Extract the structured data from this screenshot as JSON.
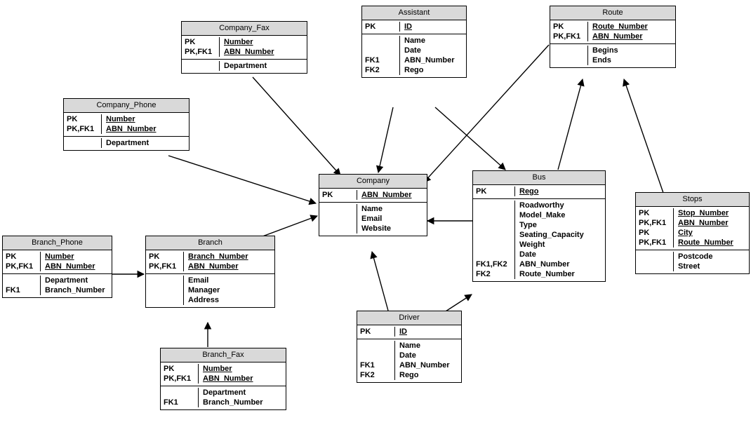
{
  "entities": {
    "company_fax": {
      "title": "Company_Fax",
      "sections": [
        {
          "keys": [
            "PK",
            "PK,FK1"
          ],
          "attrs": [
            "Number",
            "ABN_Number"
          ],
          "pk": [
            true,
            true
          ]
        },
        {
          "keys": [
            ""
          ],
          "attrs": [
            "Department"
          ],
          "pk": [
            false
          ]
        }
      ]
    },
    "company_phone": {
      "title": "Company_Phone",
      "sections": [
        {
          "keys": [
            "PK",
            "PK,FK1"
          ],
          "attrs": [
            "Number",
            "ABN_Number"
          ],
          "pk": [
            true,
            true
          ]
        },
        {
          "keys": [
            ""
          ],
          "attrs": [
            "Department"
          ],
          "pk": [
            false
          ]
        }
      ]
    },
    "branch_phone": {
      "title": "Branch_Phone",
      "sections": [
        {
          "keys": [
            "PK",
            "PK,FK1"
          ],
          "attrs": [
            "Number",
            "ABN_Number"
          ],
          "pk": [
            true,
            true
          ]
        },
        {
          "keys": [
            "",
            "FK1"
          ],
          "attrs": [
            "Department",
            "Branch_Number"
          ],
          "pk": [
            false,
            false
          ]
        }
      ]
    },
    "branch": {
      "title": "Branch",
      "sections": [
        {
          "keys": [
            "PK",
            "PK,FK1"
          ],
          "attrs": [
            "Branch_Number",
            "ABN_Number"
          ],
          "pk": [
            true,
            true
          ]
        },
        {
          "keys": [
            "",
            "",
            ""
          ],
          "attrs": [
            "Email",
            "Manager",
            "Address"
          ],
          "pk": [
            false,
            false,
            false
          ]
        }
      ]
    },
    "branch_fax": {
      "title": "Branch_Fax",
      "sections": [
        {
          "keys": [
            "PK",
            "PK,FK1"
          ],
          "attrs": [
            "Number",
            "ABN_Number"
          ],
          "pk": [
            true,
            true
          ]
        },
        {
          "keys": [
            "",
            "FK1"
          ],
          "attrs": [
            "Department",
            "Branch_Number"
          ],
          "pk": [
            false,
            false
          ]
        }
      ]
    },
    "assistant": {
      "title": "Assistant",
      "sections": [
        {
          "keys": [
            "PK"
          ],
          "attrs": [
            "ID"
          ],
          "pk": [
            true
          ]
        },
        {
          "keys": [
            "",
            "",
            "FK1",
            "FK2"
          ],
          "attrs": [
            "Name",
            "Date",
            "ABN_Number",
            "Rego"
          ],
          "pk": [
            false,
            false,
            false,
            false
          ]
        }
      ]
    },
    "company": {
      "title": "Company",
      "sections": [
        {
          "keys": [
            "PK"
          ],
          "attrs": [
            "ABN_Number"
          ],
          "pk": [
            true
          ]
        },
        {
          "keys": [
            "",
            "",
            ""
          ],
          "attrs": [
            "Name",
            "Email",
            "Website"
          ],
          "pk": [
            false,
            false,
            false
          ]
        }
      ]
    },
    "driver": {
      "title": "Driver",
      "sections": [
        {
          "keys": [
            "PK"
          ],
          "attrs": [
            "ID"
          ],
          "pk": [
            true
          ]
        },
        {
          "keys": [
            "",
            "",
            "FK1",
            "FK2"
          ],
          "attrs": [
            "Name",
            "Date",
            "ABN_Number",
            "Rego"
          ],
          "pk": [
            false,
            false,
            false,
            false
          ]
        }
      ]
    },
    "bus": {
      "title": "Bus",
      "sections": [
        {
          "keys": [
            "PK"
          ],
          "attrs": [
            "Rego"
          ],
          "pk": [
            true
          ]
        },
        {
          "keys": [
            "",
            "",
            "",
            "",
            "",
            "",
            "FK1,FK2",
            "FK2"
          ],
          "attrs": [
            "Roadworthy",
            "Model_Make",
            "Type",
            "Seating_Capacity",
            "Weight",
            "Date",
            "ABN_Number",
            "Route_Number"
          ],
          "pk": [
            false,
            false,
            false,
            false,
            false,
            false,
            false,
            false
          ]
        }
      ]
    },
    "route": {
      "title": "Route",
      "sections": [
        {
          "keys": [
            "PK",
            "PK,FK1"
          ],
          "attrs": [
            "Route_Number",
            "ABN_Number"
          ],
          "pk": [
            true,
            true
          ]
        },
        {
          "keys": [
            "",
            ""
          ],
          "attrs": [
            "Begins",
            "Ends"
          ],
          "pk": [
            false,
            false
          ]
        }
      ]
    },
    "stops": {
      "title": "Stops",
      "sections": [
        {
          "keys": [
            "PK",
            "PK,FK1",
            "PK",
            "PK,FK1"
          ],
          "attrs": [
            "Stop_Number",
            "ABN_Number",
            "City",
            "Route_Number"
          ],
          "pk": [
            true,
            true,
            true,
            true
          ]
        },
        {
          "keys": [
            "",
            ""
          ],
          "attrs": [
            "Postcode",
            "Street"
          ],
          "pk": [
            false,
            false
          ]
        }
      ]
    }
  }
}
